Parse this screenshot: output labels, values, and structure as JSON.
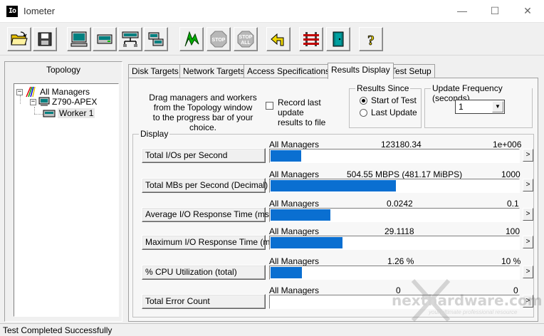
{
  "window": {
    "title": "Iometer",
    "icon_text": "Io"
  },
  "toolbar": {
    "buttons": [
      "open-config",
      "save-config",
      "show-results",
      "start-new-manager",
      "start-disk-worker",
      "start-network-worker",
      "duplicate-worker",
      "start-tests",
      "stop",
      "stop-all",
      "reset-workers",
      "exit",
      "about"
    ],
    "stop_label": "STOP",
    "stop_all_label": [
      "STOP",
      "ALL"
    ]
  },
  "topology": {
    "title": "Topology",
    "all_managers": "All Managers",
    "manager": "Z790-APEX",
    "worker": "Worker 1"
  },
  "tabs": [
    "Disk Targets",
    "Network Targets",
    "Access Specifications",
    "Results Display",
    "Test Setup"
  ],
  "active_tab": "Results Display",
  "instructions": [
    "Drag managers and workers",
    "from the Topology window",
    "to the progress bar of your choice."
  ],
  "record": {
    "label_line1": "Record last update",
    "label_line2": "results to file"
  },
  "results_since": {
    "title": "Results Since",
    "option1": "Start of Test",
    "option2": "Last Update"
  },
  "update_frequency": {
    "title": "Update Frequency (seconds)",
    "value": "1"
  },
  "display": {
    "title": "Display",
    "rows": [
      {
        "button": "Total I/Os per Second",
        "label": "All Managers",
        "value": "123180.34",
        "max": "1e+006",
        "fraction": 0.123
      },
      {
        "button": "Total MBs per Second (Decimal)",
        "label": "All Managers",
        "value": "504.55 MBPS (481.17 MiBPS)",
        "max": "1000",
        "fraction": 0.505
      },
      {
        "button": "Average I/O Response Time (ms)",
        "label": "All Managers",
        "value": "0.0242",
        "max": "0.1",
        "fraction": 0.242
      },
      {
        "button": "Maximum I/O Response Time (ms)",
        "label": "All Managers",
        "value": "29.1118",
        "max": "100",
        "fraction": 0.291
      },
      {
        "button": "% CPU Utilization (total)",
        "label": "All Managers",
        "value": "1.26 %",
        "max": "10 %",
        "fraction": 0.126
      },
      {
        "button": "Total Error Count",
        "label": "All Managers",
        "value": "0",
        "max": "0",
        "fraction": 0
      }
    ],
    "expand_glyph": ">"
  },
  "status": {
    "text": "Test Completed Successfully"
  },
  "watermark": {
    "text": "nexthardware.com",
    "sub": "your ultimate professional resource"
  },
  "colors": {
    "bar": "#0a6fd1",
    "window_bg": "#f0f0f0"
  }
}
